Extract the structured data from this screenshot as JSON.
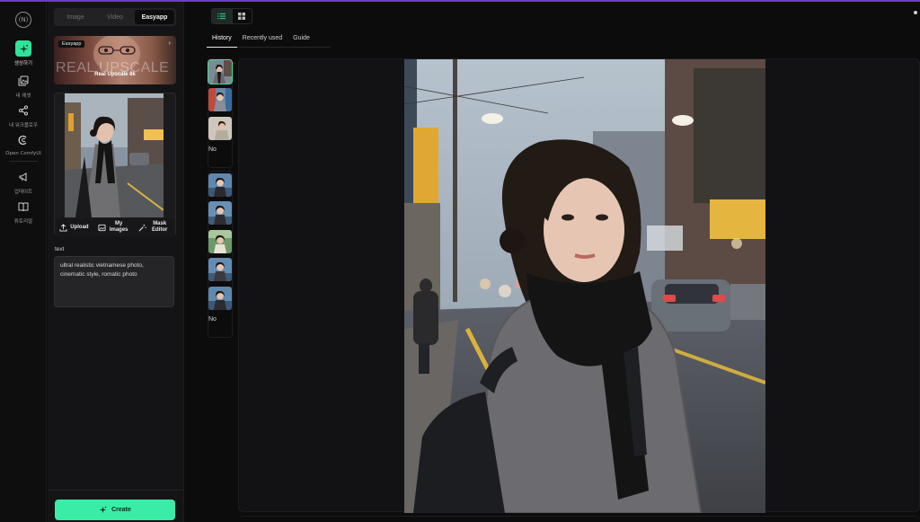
{
  "rail": {
    "logo": "(N)",
    "items": [
      {
        "label": "생성하기",
        "icon": "sparkle-icon",
        "active": true
      },
      {
        "label": "내 에셋",
        "icon": "gallery-icon"
      },
      {
        "label": "내 워크플로우",
        "icon": "workflow-icon"
      },
      {
        "label": "Open ComfyUI",
        "icon": "comfyui-icon"
      },
      {
        "label": "업데이트",
        "icon": "megaphone-icon"
      },
      {
        "label": "튜토리얼",
        "icon": "book-icon"
      }
    ]
  },
  "panel": {
    "mode_tabs": [
      "Image",
      "Video",
      "Easyapp"
    ],
    "active_mode": "Easyapp",
    "banner": {
      "tag": "Easyapp",
      "big_text": "REAL UPSCALE",
      "caption": "Real Upscale 8k"
    },
    "actions": {
      "upload": "Upload",
      "my_images": "My Images",
      "mask_editor": "Mask Editor"
    },
    "text_label": "text",
    "prompt": "ultral realistic vietnamese photo, cinematic style, romatic photo",
    "create_label": "Create"
  },
  "main": {
    "tabs": [
      "History",
      "Recently used",
      "Guide"
    ],
    "active_tab": "History",
    "no_label": "No"
  },
  "colors": {
    "accent": "#3aeda6",
    "topline": "#6a3dc8"
  }
}
